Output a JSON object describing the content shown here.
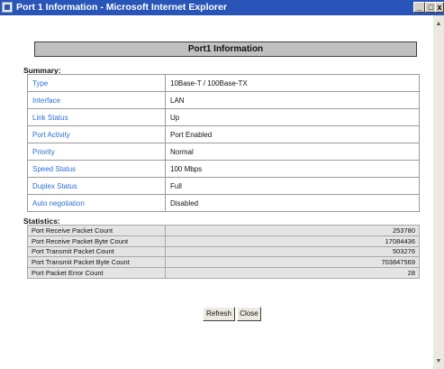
{
  "window": {
    "title": "Port 1 Information - Microsoft Internet Explorer"
  },
  "header": {
    "title": "Port1 Information"
  },
  "summary": {
    "label": "Summary:",
    "rows": [
      {
        "key": "Type",
        "value": "10Base-T / 100Base-TX"
      },
      {
        "key": "Interface",
        "value": "LAN"
      },
      {
        "key": "Link Status",
        "value": "Up"
      },
      {
        "key": "Port Activity",
        "value": "Port Enabled"
      },
      {
        "key": "Priority",
        "value": "Normal"
      },
      {
        "key": "Speed Status",
        "value": "100 Mbps"
      },
      {
        "key": "Duplex Status",
        "value": "Full"
      },
      {
        "key": "Auto negotiation",
        "value": "Disabled"
      }
    ]
  },
  "statistics": {
    "label": "Statistics:",
    "rows": [
      {
        "key": "Port Receive Packet Count",
        "value": "253780"
      },
      {
        "key": "Port Receive Packet Byte Count",
        "value": "17084436"
      },
      {
        "key": "Port Transmit Packet Count",
        "value": "503276"
      },
      {
        "key": "Port Transmit Packet Byte Count",
        "value": "703847569"
      },
      {
        "key": "Port Packet Error Count",
        "value": "28"
      }
    ]
  },
  "buttons": {
    "refresh": "Refresh",
    "close": "Close"
  },
  "window_controls": {
    "minimize": "_",
    "maximize": "□",
    "close": "x"
  },
  "icons": {
    "app": "ie-page-icon",
    "scroll_up": "scroll-up-arrow",
    "scroll_down": "scroll-down-arrow"
  },
  "colors": {
    "titlebar": "#2a55b8",
    "key_text": "#2e6fd6",
    "header_bar": "#c0c0c0"
  }
}
